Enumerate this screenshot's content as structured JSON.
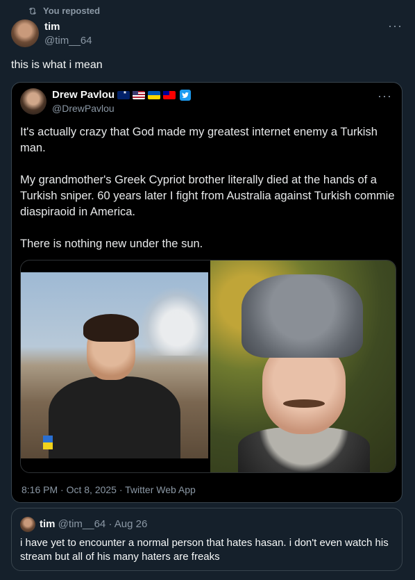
{
  "repost": {
    "label": "You reposted"
  },
  "post": {
    "name": "tim",
    "handle": "@tim__64",
    "text": "this is what i mean",
    "more": "···"
  },
  "quoted": {
    "name": "Drew Pavlou",
    "handle": "@DrewPavlou",
    "more": "···",
    "paragraphs": [
      "It's actually crazy that God made my greatest internet enemy a Turkish man.",
      "My grandmother's Greek Cypriot brother literally died at the hands of a Turkish sniper. 60 years later I fight from Australia against Turkish commie diaspiraoid in America.",
      "There is nothing new under the sun."
    ],
    "meta": "8:16 PM · Oct 8, 2025 · Twitter Web App"
  },
  "nested_quote": {
    "name": "tim",
    "handle": "@tim__64",
    "date": "· Aug 26",
    "text": "i have yet to encounter a normal person that hates hasan. i don't even watch his stream but all of his many haters are freaks"
  },
  "colors": {
    "background": "#15202b",
    "card": "#000000",
    "secondary_text": "#8b98a5",
    "border": "#38444d",
    "accent": "#1d9bf0"
  }
}
